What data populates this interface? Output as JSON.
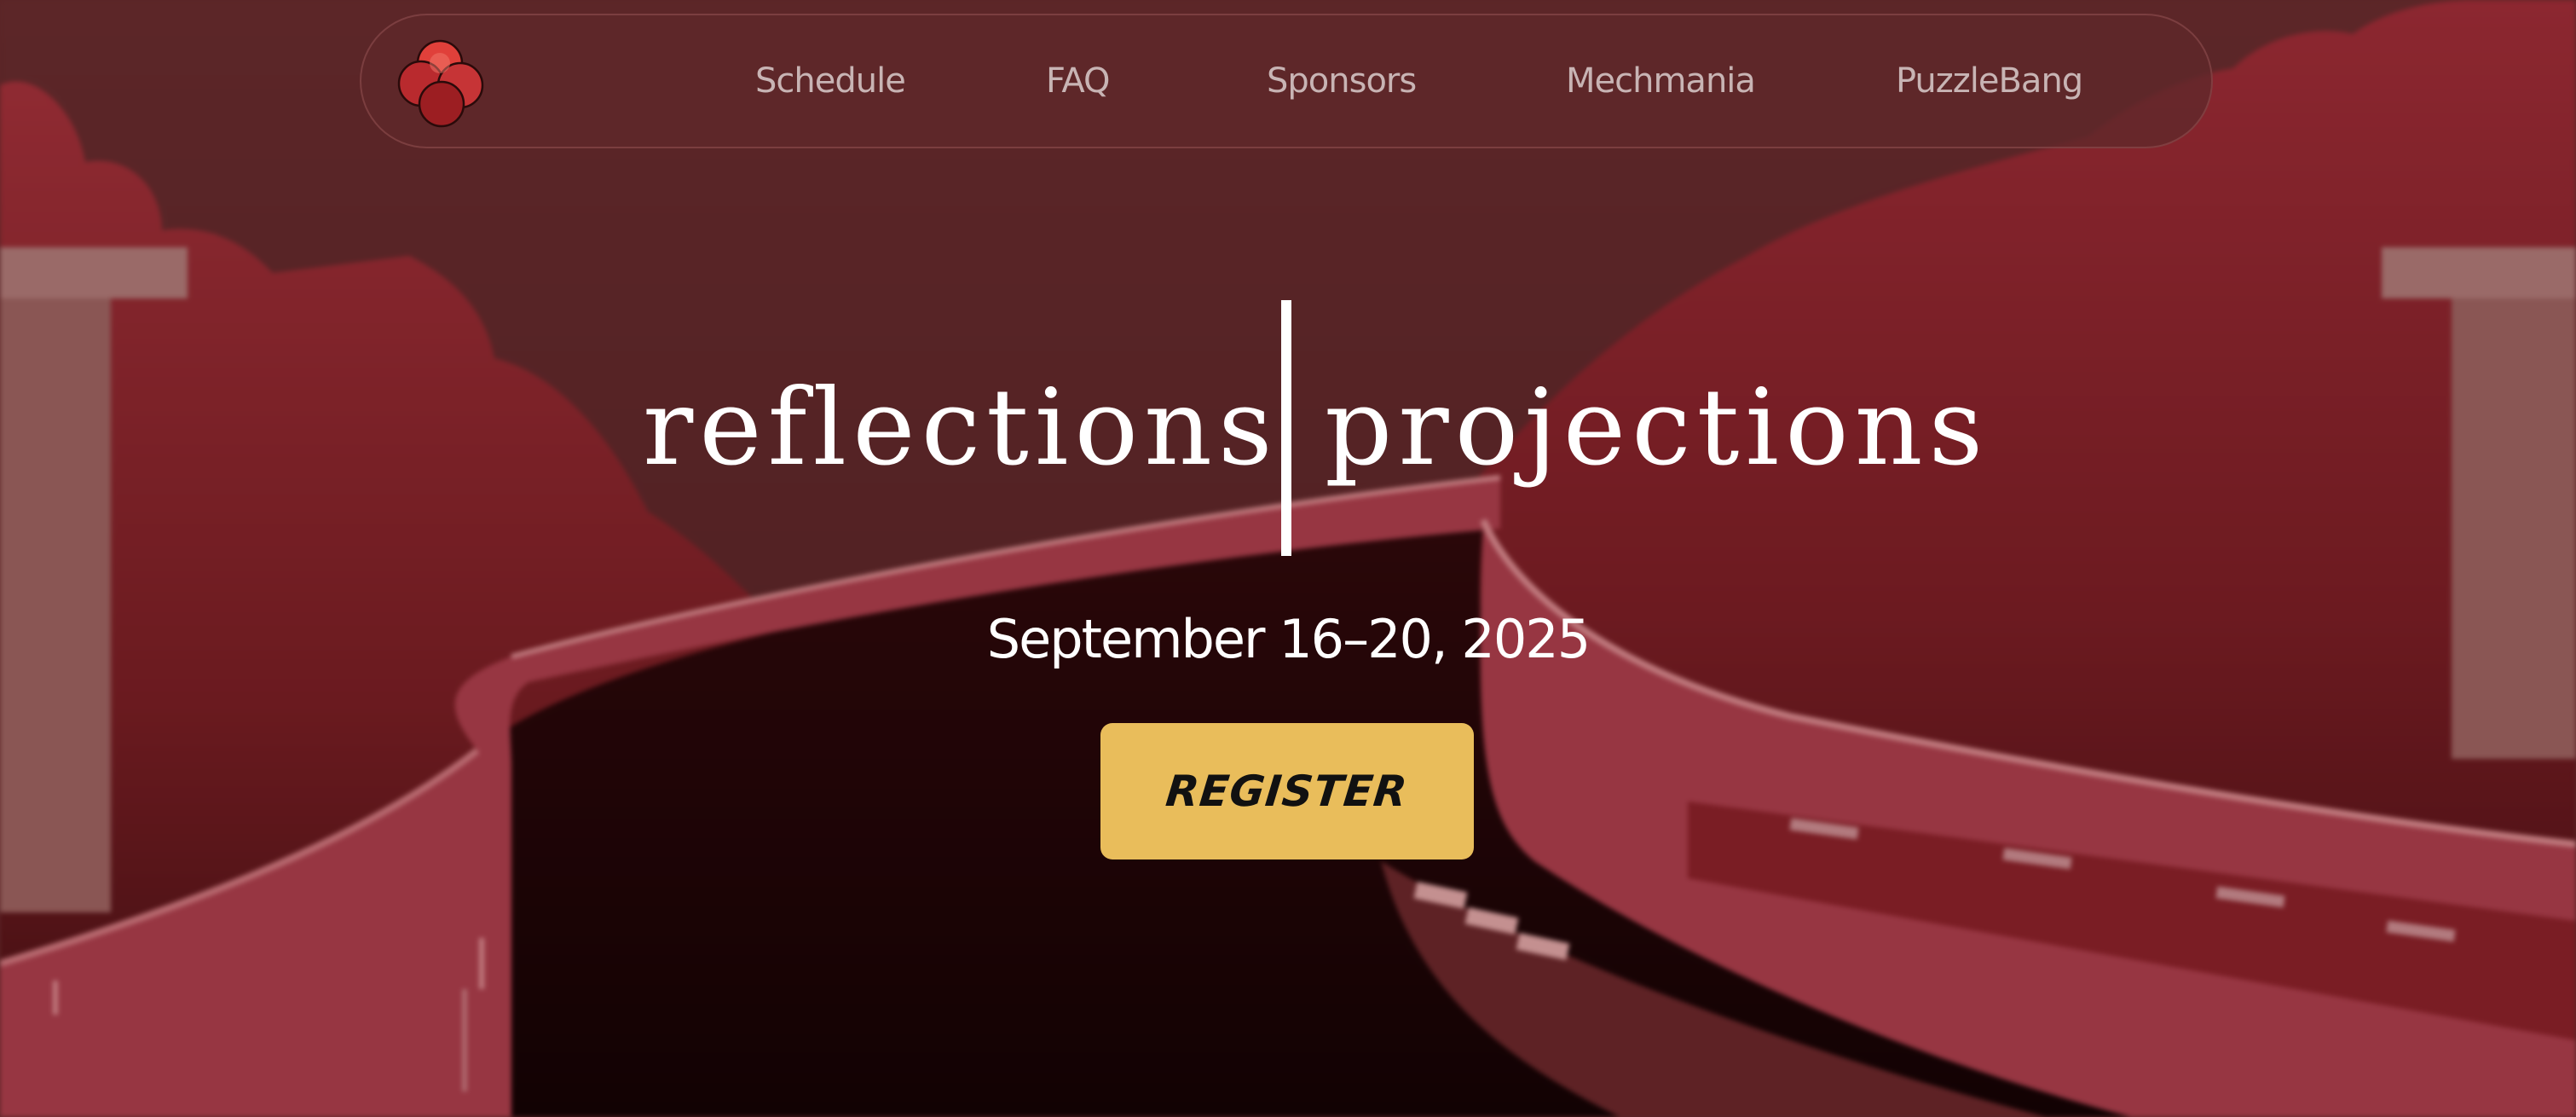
{
  "nav": {
    "links": [
      {
        "label": "Schedule"
      },
      {
        "label": "FAQ"
      },
      {
        "label": "Sponsors"
      },
      {
        "label": "Mechmania"
      },
      {
        "label": "PuzzleBang"
      }
    ],
    "logo_icon": "four-overlapping-circles-logo"
  },
  "hero": {
    "title_left": "reflections",
    "title_right": "projections",
    "date": "September 16–20, 2025",
    "register_label": "REGISTER"
  },
  "colors": {
    "background": "#5a2527",
    "accent_red": "#9a3340",
    "button_gold": "#e9bd5b",
    "nav_text": "#c8b4b4",
    "hero_text": "#ffffff"
  }
}
